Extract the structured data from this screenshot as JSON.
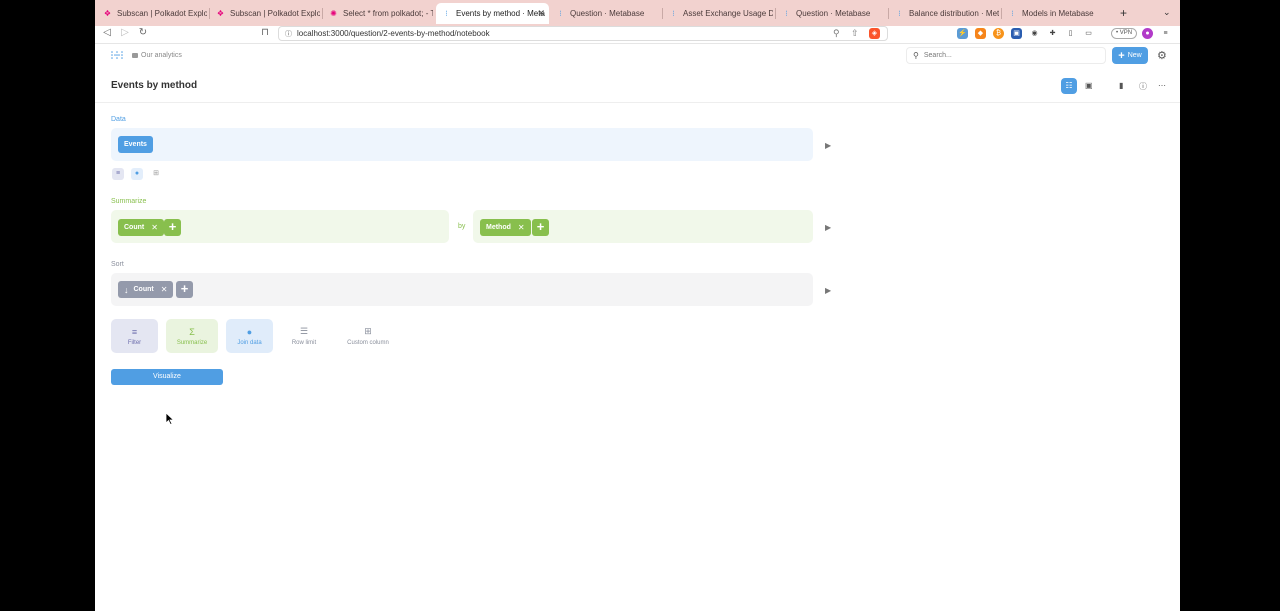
{
  "browser": {
    "tabs": [
      {
        "title": "Subscan | Polkadot Explorer",
        "icon": "subscan-icon",
        "active": false
      },
      {
        "title": "Subscan | Polkadot Explorer",
        "icon": "subscan-icon",
        "active": false
      },
      {
        "title": "Select * from polkadot; - Te",
        "icon": "polkadot-icon",
        "active": false
      },
      {
        "title": "Events by method · Meta",
        "icon": "metabase-icon",
        "active": true
      },
      {
        "title": "Question · Metabase",
        "icon": "metabase-icon",
        "active": false
      },
      {
        "title": "Asset Exchange Usage Distr",
        "icon": "metabase-icon",
        "active": false
      },
      {
        "title": "Question · Metabase",
        "icon": "metabase-icon",
        "active": false
      },
      {
        "title": "Balance distribution · Meta",
        "icon": "metabase-icon",
        "active": false
      },
      {
        "title": "Models in Metabase",
        "icon": "metabase-icon",
        "active": false
      }
    ],
    "url": "localhost:3000/question/2-events-by-method/notebook",
    "vpn_label": "• VPN"
  },
  "app": {
    "breadcrumb": "Our analytics",
    "search_placeholder": "Search...",
    "new_label": "New"
  },
  "question": {
    "title": "Events by method"
  },
  "notebook": {
    "data_label": "Data",
    "source_table": "Events",
    "summarize_label": "Summarize",
    "metric": "Count",
    "by_label": "by",
    "breakout": "Method",
    "sort_label": "Sort",
    "sort_field": "Count",
    "actions": [
      "Filter",
      "Summarize",
      "Join data",
      "Row limit",
      "Custom column"
    ],
    "visualize_label": "Visualize"
  },
  "colors": {
    "brand": "#509ee3",
    "summarize": "#88bf4d",
    "sort": "#949aab",
    "tab_strip": "#f2d2cf"
  }
}
